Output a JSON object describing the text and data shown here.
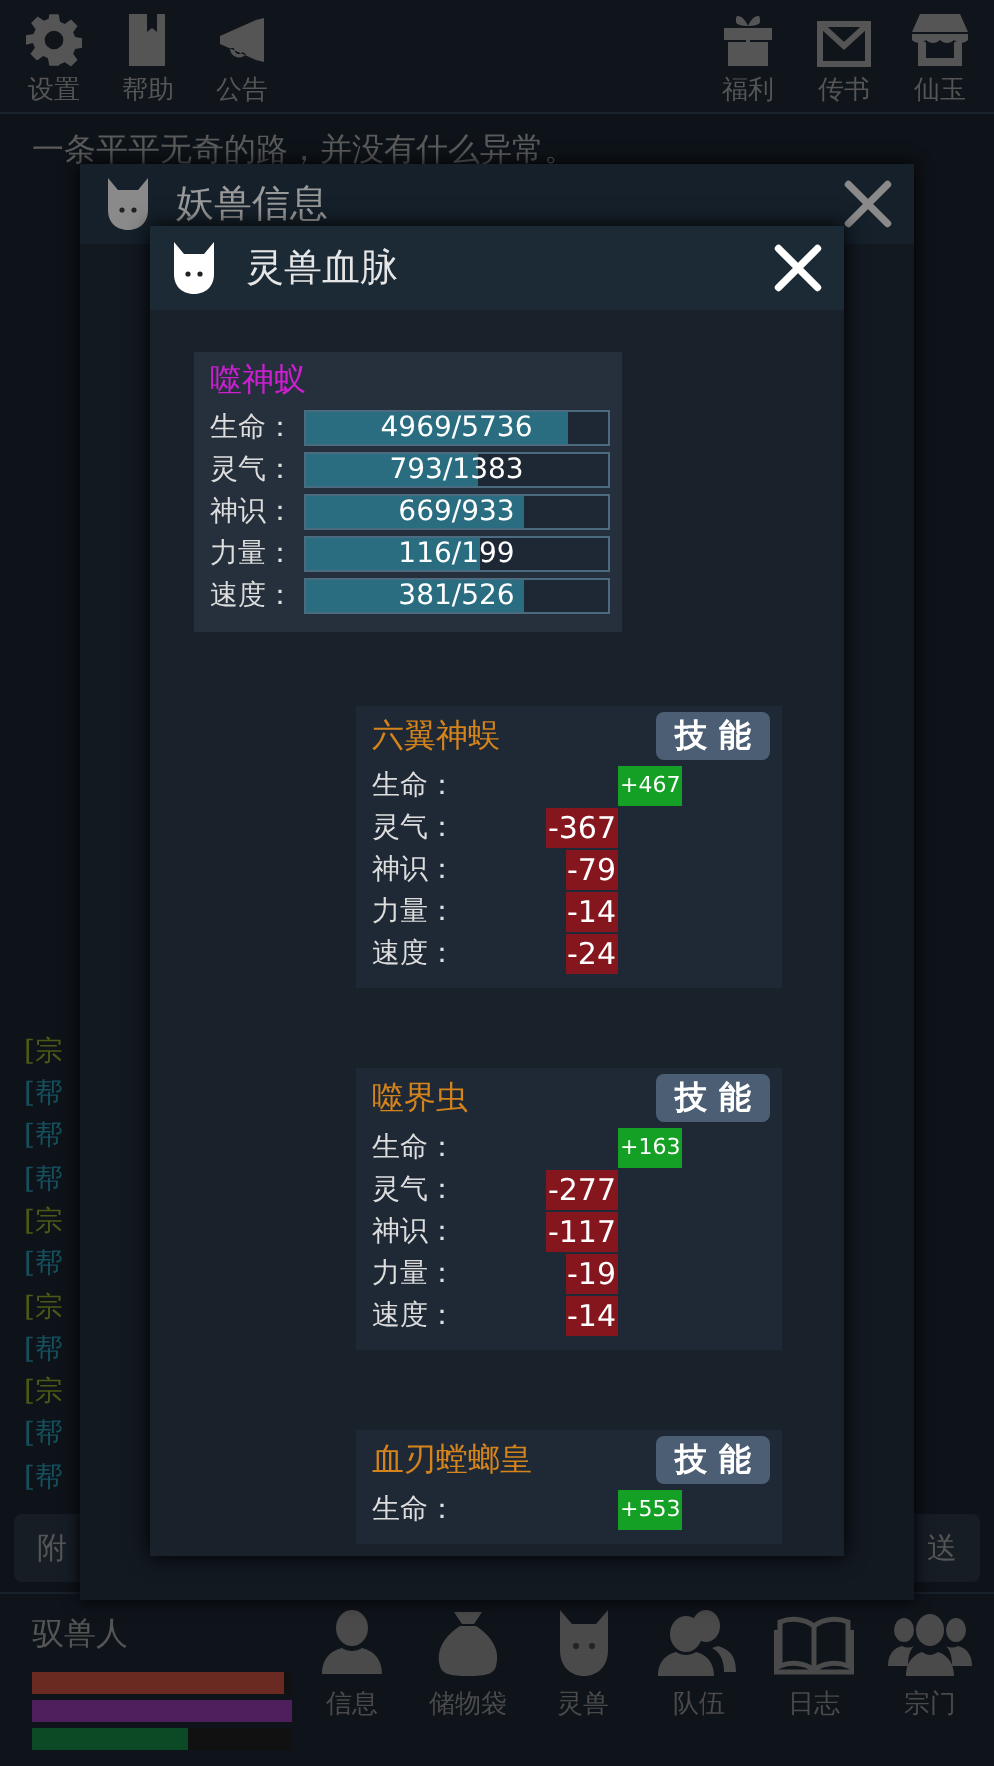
{
  "top_bar": {
    "left": [
      {
        "label": "设置"
      },
      {
        "label": "帮助"
      },
      {
        "label": "公告"
      }
    ],
    "right": [
      {
        "label": "福利"
      },
      {
        "label": "传书"
      },
      {
        "label": "仙玉"
      }
    ]
  },
  "message": "一条平平无奇的路，并没有什么异常。",
  "log": [
    {
      "kind": "sect",
      "text": "[宗"
    },
    {
      "kind": "gang",
      "text": "[帮"
    },
    {
      "kind": "gang",
      "text": "[帮"
    },
    {
      "kind": "gang",
      "text": "[帮"
    },
    {
      "kind": "sect",
      "text": "[宗"
    },
    {
      "kind": "gang",
      "text": "[帮"
    },
    {
      "kind": "sect",
      "text": "[宗"
    },
    {
      "kind": "gang",
      "text": "[帮"
    },
    {
      "kind": "sect",
      "text": "[宗"
    },
    {
      "kind": "gang",
      "text": "[帮"
    },
    {
      "kind": "gang",
      "text": "[帮"
    }
  ],
  "bottom_buttons": [
    "附",
    "送"
  ],
  "player": {
    "name": "驭兽人",
    "bars": [
      {
        "level": 0.97,
        "color": "#6a2a22"
      },
      {
        "level": 1,
        "color": "#4e1f5a"
      },
      {
        "level": 0.6,
        "color": "#0c4a26"
      }
    ]
  },
  "nav": [
    {
      "label": "信息"
    },
    {
      "label": "储物袋"
    },
    {
      "label": "灵兽"
    },
    {
      "label": "队伍"
    },
    {
      "label": "日志"
    },
    {
      "label": "宗门"
    }
  ],
  "beast_dialog": {
    "title": "妖兽信息"
  },
  "bloodline_dialog": {
    "title": "灵兽血脉",
    "beast": {
      "name": "噬神蚁",
      "stats": [
        {
          "label": "生命：",
          "value": "4969/5736",
          "level": 0.87
        },
        {
          "label": "灵气：",
          "value": "793/1383",
          "level": 0.57
        },
        {
          "label": "神识：",
          "value": "669/933",
          "level": 0.72
        },
        {
          "label": "力量：",
          "value": "116/199",
          "level": 0.58
        },
        {
          "label": "速度：",
          "value": "381/526",
          "level": 0.72
        }
      ]
    },
    "lineages": [
      {
        "name": "六翼神蜈",
        "skill_button": "技 能",
        "stats": [
          {
            "label": "生命：",
            "value": "+467",
            "kind": "gain"
          },
          {
            "label": "灵气：",
            "value": "-367",
            "kind": "loss"
          },
          {
            "label": "神识：",
            "value": "-79",
            "kind": "loss"
          },
          {
            "label": "力量：",
            "value": "-14",
            "kind": "loss"
          },
          {
            "label": "速度：",
            "value": "-24",
            "kind": "loss"
          }
        ]
      },
      {
        "name": "噬界虫",
        "skill_button": "技 能",
        "stats": [
          {
            "label": "生命：",
            "value": "+163",
            "kind": "gain"
          },
          {
            "label": "灵气：",
            "value": "-277",
            "kind": "loss"
          },
          {
            "label": "神识：",
            "value": "-117",
            "kind": "loss"
          },
          {
            "label": "力量：",
            "value": "-19",
            "kind": "loss"
          },
          {
            "label": "速度：",
            "value": "-14",
            "kind": "loss"
          }
        ]
      },
      {
        "name": "血刃螳螂皇",
        "skill_button": "技 能",
        "stats": [
          {
            "label": "生命：",
            "value": "+553",
            "kind": "gain"
          }
        ]
      }
    ]
  }
}
